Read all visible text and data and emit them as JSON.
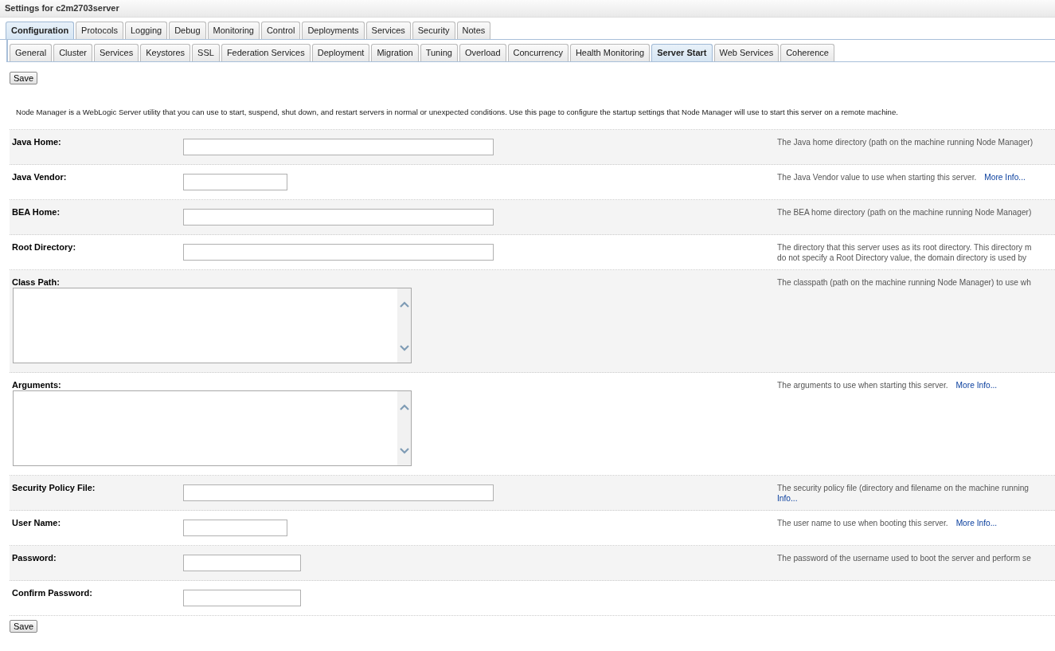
{
  "window": {
    "title": "Settings for c2m2703server"
  },
  "tabs": [
    {
      "label": "Configuration",
      "selected": true
    },
    {
      "label": "Protocols",
      "selected": false
    },
    {
      "label": "Logging",
      "selected": false
    },
    {
      "label": "Debug",
      "selected": false
    },
    {
      "label": "Monitoring",
      "selected": false
    },
    {
      "label": "Control",
      "selected": false
    },
    {
      "label": "Deployments",
      "selected": false
    },
    {
      "label": "Services",
      "selected": false
    },
    {
      "label": "Security",
      "selected": false
    },
    {
      "label": "Notes",
      "selected": false
    }
  ],
  "subtabs": [
    {
      "label": "General",
      "selected": false
    },
    {
      "label": "Cluster",
      "selected": false
    },
    {
      "label": "Services",
      "selected": false
    },
    {
      "label": "Keystores",
      "selected": false
    },
    {
      "label": "SSL",
      "selected": false
    },
    {
      "label": "Federation Services",
      "selected": false
    },
    {
      "label": "Deployment",
      "selected": false
    },
    {
      "label": "Migration",
      "selected": false
    },
    {
      "label": "Tuning",
      "selected": false
    },
    {
      "label": "Overload",
      "selected": false
    },
    {
      "label": "Concurrency",
      "selected": false
    },
    {
      "label": "Health Monitoring",
      "selected": false
    },
    {
      "label": "Server Start",
      "selected": true
    },
    {
      "label": "Web Services",
      "selected": false
    },
    {
      "label": "Coherence",
      "selected": false
    }
  ],
  "top_button": "Save",
  "intro": "Node Manager is a WebLogic Server utility that you can use to start, suspend, shut down, and restart servers in normal or unexpected conditions. Use this page to configure the startup settings that Node Manager will use to start this server on a remote machine.",
  "fields": [
    {
      "kind": "longinput",
      "label": "Java Home:",
      "help": [
        [
          {
            "kind": "text",
            "text": "The Java home directory (path on the machine running Node Manager)"
          }
        ]
      ]
    },
    {
      "kind": "shortinput",
      "label": "Java Vendor:",
      "help": [
        [
          {
            "kind": "text",
            "text": "The Java Vendor value to use when starting this server."
          },
          {
            "kind": "link",
            "text": "More Info..."
          }
        ]
      ]
    },
    {
      "kind": "longinput",
      "label": "BEA Home:",
      "help": [
        [
          {
            "kind": "text",
            "text": "The BEA home directory (path on the machine running Node Manager)"
          }
        ]
      ]
    },
    {
      "kind": "longinput",
      "label": "Root Directory:",
      "help": [
        [
          {
            "kind": "text",
            "text": "The directory that this server uses as its root directory. This directory m"
          }
        ],
        [
          {
            "kind": "text",
            "text": "do not specify a Root Directory value, the domain directory is used by"
          }
        ]
      ]
    },
    {
      "kind": "textarea",
      "label": "Class Path:",
      "help": [
        [
          {
            "kind": "text",
            "text": "The classpath (path on the machine running Node Manager) to use wh"
          }
        ]
      ]
    },
    {
      "kind": "textarea",
      "label": "Arguments:",
      "help": [
        [
          {
            "kind": "text",
            "text": "The arguments to use when starting this server."
          },
          {
            "kind": "link",
            "text": "More Info..."
          }
        ]
      ]
    },
    {
      "kind": "longinput",
      "label": "Security Policy File:",
      "help": [
        [
          {
            "kind": "text",
            "text": "The security policy file (directory and filename on the machine running"
          }
        ],
        [
          {
            "kind": "link",
            "text": "Info..."
          }
        ]
      ]
    },
    {
      "kind": "shortinput",
      "label": "User Name:",
      "help": [
        [
          {
            "kind": "text",
            "text": "The user name to use when booting this server."
          },
          {
            "kind": "link",
            "text": "More Info..."
          }
        ]
      ]
    },
    {
      "kind": "password",
      "label": "Password:",
      "help": [
        [
          {
            "kind": "text",
            "text": "The password of the username used to boot the server and perform se"
          }
        ]
      ]
    },
    {
      "kind": "password",
      "label": "Confirm Password:"
    }
  ],
  "bottom_button": "Save"
}
